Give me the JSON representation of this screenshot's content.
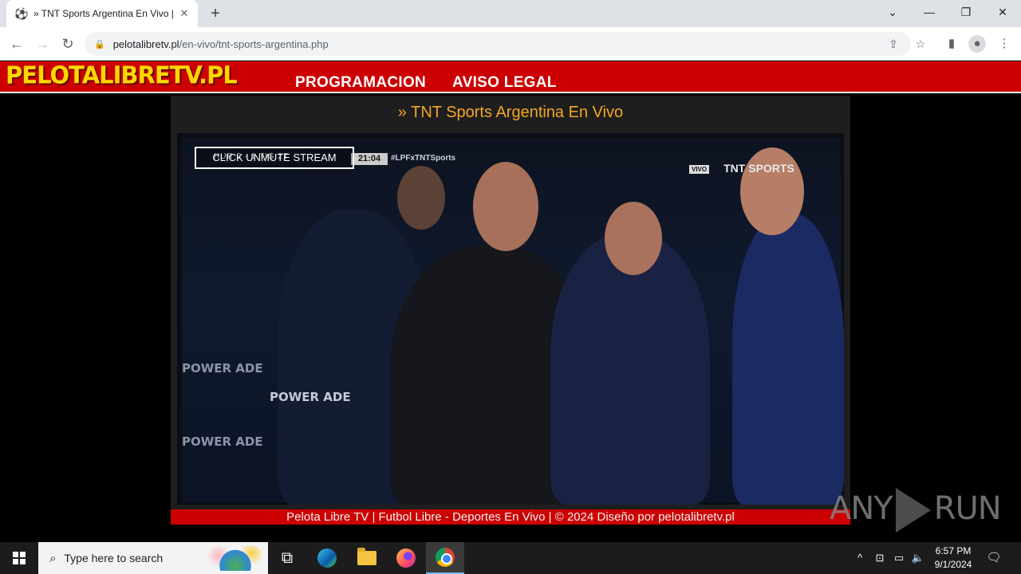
{
  "browser": {
    "tab_title": "» TNT Sports Argentina En Vivo |",
    "tab_favicon": "soccer-ball-icon",
    "url_domain": "pelotalibretv.pl",
    "url_path": "/en-vivo/tnt-sports-argentina.php"
  },
  "site": {
    "logo": "PELOTALIBRETV.PL",
    "nav": [
      "PROGRAMACION",
      "AVISO LEGAL"
    ],
    "colors": {
      "header_red": "#cc0000",
      "logo_yellow": "#ffd700",
      "title_orange": "#f5a623"
    }
  },
  "page": {
    "title": "» TNT Sports Argentina En Vivo"
  },
  "player": {
    "unmute_label": "CLICK UNMUTE STREAM",
    "score_text": "HUR 0 - 1 TIG 2T",
    "match_clock": "21:04",
    "hashtag": "#LPFxTNTSports",
    "live_badge": "VIVO",
    "broadcaster": "TNT SPORTS",
    "ad_board": "POWER ADE"
  },
  "footer": {
    "text": "Pelota Libre TV | Futbol Libre - Deportes En Vivo | © 2024 Diseño por pelotalibretv.pl"
  },
  "watermark": {
    "left": "ANY",
    "right": "RUN"
  },
  "taskbar": {
    "search_placeholder": "Type here to search",
    "time": "6:57 PM",
    "date": "9/1/2024"
  }
}
